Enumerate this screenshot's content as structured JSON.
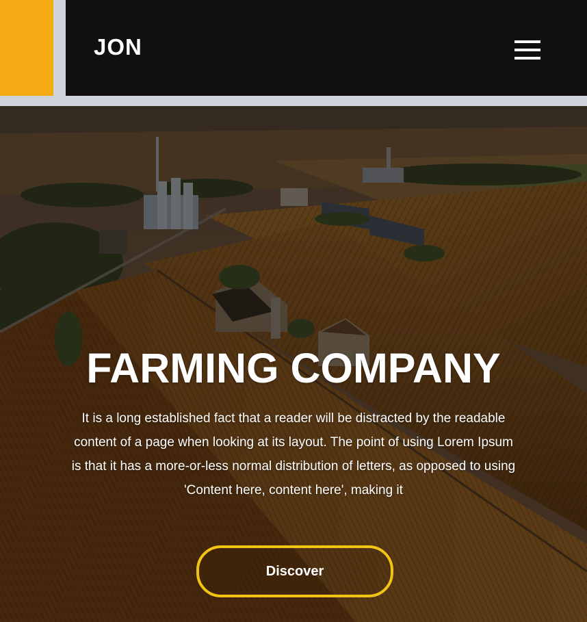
{
  "header": {
    "logo": "JON",
    "menu_icon": "hamburger-menu-icon"
  },
  "hero": {
    "title": "FARMING COMPANY",
    "text": "It is a long established fact that a reader will be distracted by the readable content of a page when looking at its layout. The point of using Lorem Ipsum is that it has a more-or-less normal distribution of letters, as opposed to using 'Content here, content here', making it",
    "button_label": "Discover"
  },
  "colors": {
    "accent": "#f5a912",
    "header_bg": "#12100e",
    "button_border": "#f2c316",
    "page_bg": "#cfd3da"
  }
}
